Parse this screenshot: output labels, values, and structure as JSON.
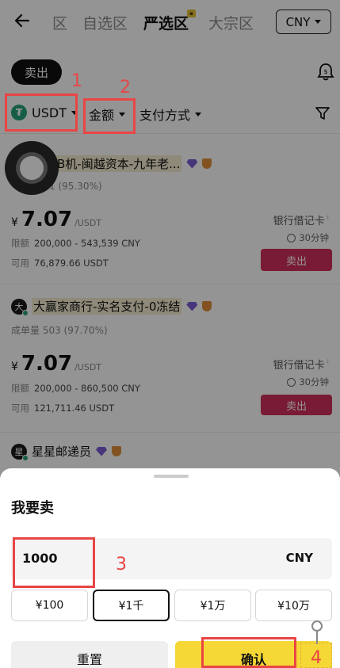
{
  "header": {
    "tabs": [
      "区",
      "自选区",
      "严选区",
      "大宗区"
    ],
    "active_tab": "严选区",
    "currency": "CNY"
  },
  "actions": {
    "sell_label": "卖出"
  },
  "filters": {
    "asset": "USDT",
    "amount": "金额",
    "payment": "支付方式"
  },
  "annotations": [
    "1",
    "2",
    "3",
    "4"
  ],
  "ads": [
    {
      "merchant": "B机-闽越资本-九年老...",
      "avatar": "",
      "stats": "1 (95.30%)",
      "price": "7.07",
      "price_unit": "/USDT",
      "limit_label": "限额",
      "limit": "200,000 - 543,539 CNY",
      "available_label": "可用",
      "available": "76,879.66 USDT",
      "pay_method": "银行借记卡",
      "time": "30分钟",
      "button": "卖出"
    },
    {
      "merchant": "大赢家商行-实名支付-0冻结",
      "avatar": "大",
      "stats": "成单量 503 (97.70%)",
      "price": "7.07",
      "price_unit": "/USDT",
      "limit_label": "限额",
      "limit": "200,000 - 860,500 CNY",
      "available_label": "可用",
      "available": "121,711.46 USDT",
      "pay_method": "银行借记卡",
      "time": "30分钟",
      "button": "卖出"
    },
    {
      "merchant": "星星邮递员",
      "avatar": "星"
    }
  ],
  "sheet": {
    "title": "我要卖",
    "amount_value": "1000",
    "amount_currency": "CNY",
    "chips": [
      "¥100",
      "¥1千",
      "¥1万",
      "¥10万"
    ],
    "selected_chip": "¥1千",
    "reset_label": "重置",
    "confirm_label": "确认"
  },
  "colors": {
    "sell_red": "#d12f5a",
    "confirm_yellow": "#f5d735",
    "annotation_red": "#e94545",
    "usdt_green": "#26a17b"
  }
}
